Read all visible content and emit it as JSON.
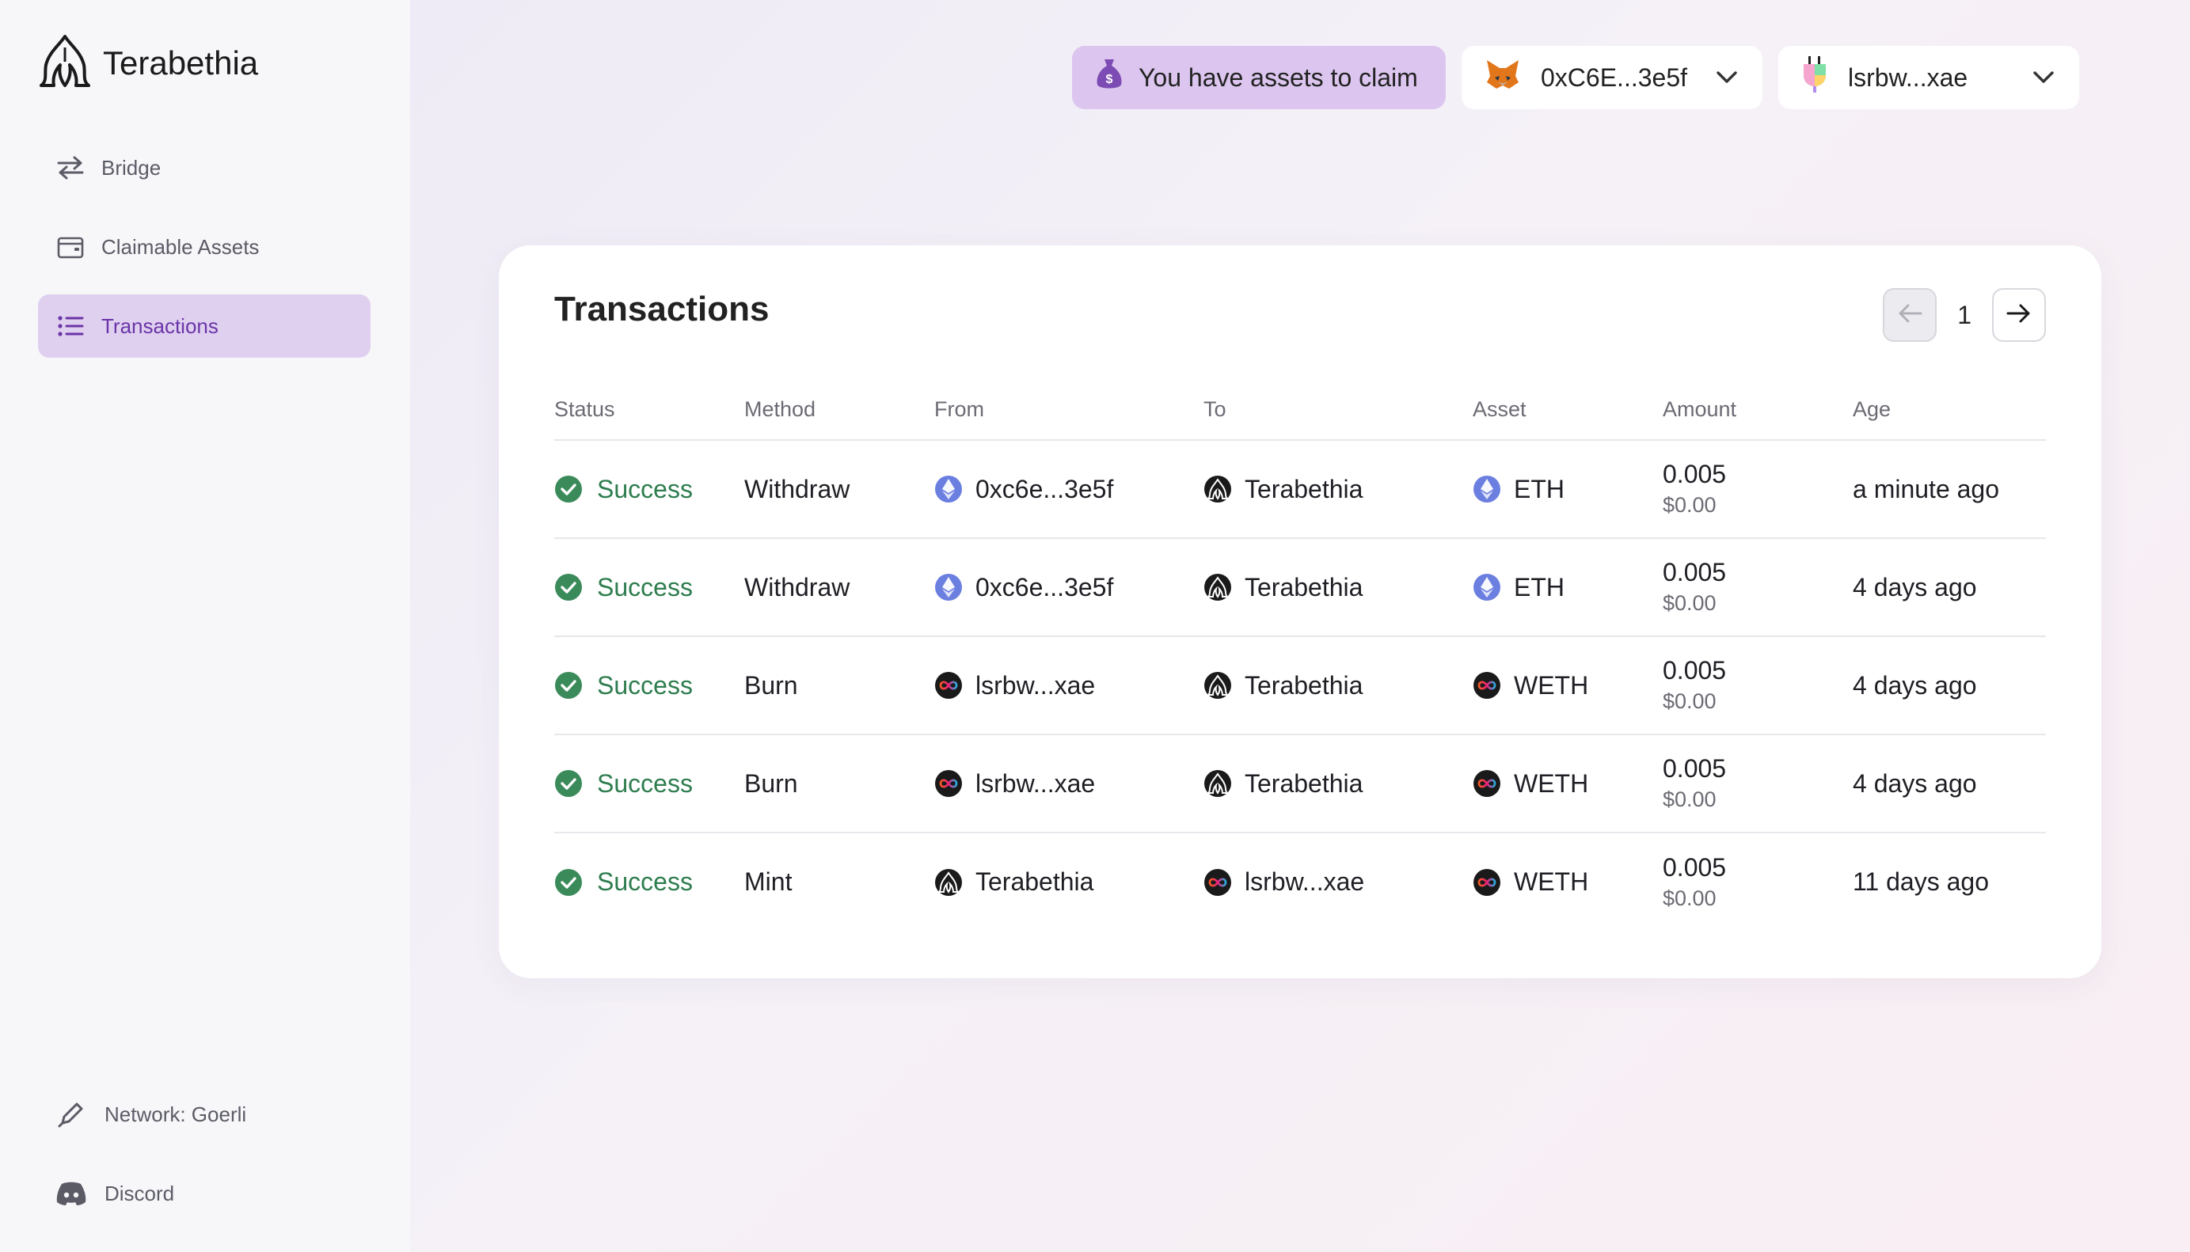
{
  "app": {
    "name": "Terabethia"
  },
  "sidebar": {
    "items": [
      {
        "label": "Bridge",
        "icon": "arrows-swap-icon"
      },
      {
        "label": "Claimable Assets",
        "icon": "wallet-icon"
      },
      {
        "label": "Transactions",
        "icon": "list-icon",
        "active": true
      }
    ],
    "bottom": [
      {
        "label": "Network: Goerli",
        "icon": "pencil-icon"
      },
      {
        "label": "Discord",
        "icon": "discord-icon"
      }
    ]
  },
  "header": {
    "claim_label": "You have assets to claim",
    "wallet_address": "0xC6E...3e5f",
    "account_id": "lsrbw...xae"
  },
  "transactions": {
    "title": "Transactions",
    "page": "1",
    "columns": [
      "Status",
      "Method",
      "From",
      "To",
      "Asset",
      "Amount",
      "Age"
    ],
    "rows": [
      {
        "status": "Success",
        "method": "Withdraw",
        "from": "0xc6e...3e5f",
        "from_icon": "ethereum-icon",
        "to": "Terabethia",
        "to_icon": "terabethia-icon",
        "asset": "ETH",
        "asset_icon": "ethereum-icon",
        "amount": "0.005",
        "usd": "$0.00",
        "age": "a minute ago"
      },
      {
        "status": "Success",
        "method": "Withdraw",
        "from": "0xc6e...3e5f",
        "from_icon": "ethereum-icon",
        "to": "Terabethia",
        "to_icon": "terabethia-icon",
        "asset": "ETH",
        "asset_icon": "ethereum-icon",
        "amount": "0.005",
        "usd": "$0.00",
        "age": "4 days ago"
      },
      {
        "status": "Success",
        "method": "Burn",
        "from": "lsrbw...xae",
        "from_icon": "internet-computer-icon",
        "to": "Terabethia",
        "to_icon": "terabethia-icon",
        "asset": "WETH",
        "asset_icon": "internet-computer-icon",
        "amount": "0.005",
        "usd": "$0.00",
        "age": "4 days ago"
      },
      {
        "status": "Success",
        "method": "Burn",
        "from": "lsrbw...xae",
        "from_icon": "internet-computer-icon",
        "to": "Terabethia",
        "to_icon": "terabethia-icon",
        "asset": "WETH",
        "asset_icon": "internet-computer-icon",
        "amount": "0.005",
        "usd": "$0.00",
        "age": "4 days ago"
      },
      {
        "status": "Success",
        "method": "Mint",
        "from": "Terabethia",
        "from_icon": "terabethia-icon",
        "to": "lsrbw...xae",
        "to_icon": "internet-computer-icon",
        "asset": "WETH",
        "asset_icon": "internet-computer-icon",
        "amount": "0.005",
        "usd": "$0.00",
        "age": "11 days ago"
      }
    ]
  },
  "colors": {
    "accent": "#6b35a8",
    "active_bg": "#dfd0f0",
    "claim_bg": "#dcc6ef",
    "success": "#2e7d4f",
    "success_icon": "#3b8b5a",
    "eth": "#6b7fe0"
  }
}
